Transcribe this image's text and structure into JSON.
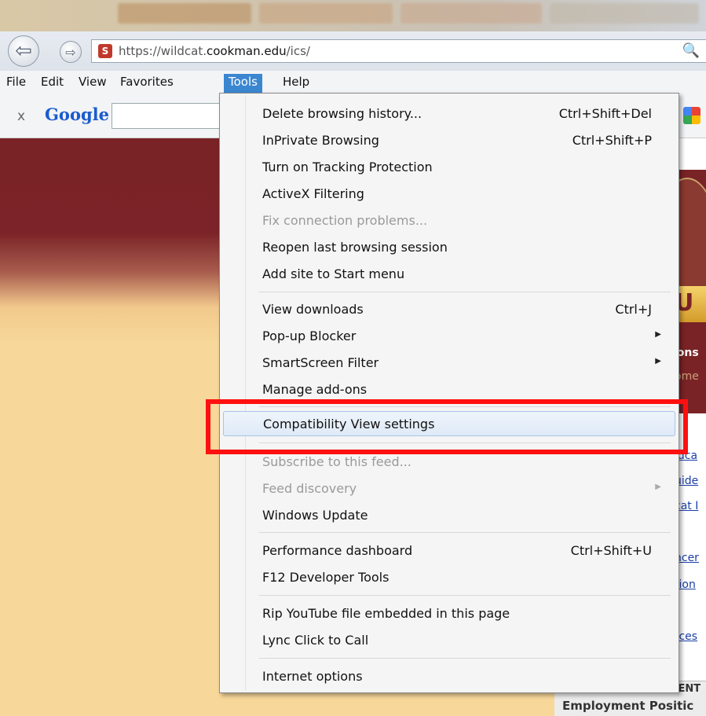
{
  "browser": {
    "url_prefix": "https://wildcat.",
    "url_host": "cookman.edu",
    "url_suffix": "/ics/",
    "search_icon": "🔍"
  },
  "menubar": {
    "items": [
      "File",
      "Edit",
      "View",
      "Favorites",
      "Tools",
      "Help"
    ],
    "active": "Tools"
  },
  "google_toolbar": {
    "close_glyph": "x",
    "logo": "Google",
    "search_value": ""
  },
  "tools_menu": {
    "items": [
      {
        "label": "Delete browsing history...",
        "shortcut": "Ctrl+Shift+Del"
      },
      {
        "label": "InPrivate Browsing",
        "shortcut": "Ctrl+Shift+P"
      },
      {
        "label": "Turn on Tracking Protection",
        "shortcut": ""
      },
      {
        "label": "ActiveX Filtering",
        "shortcut": ""
      },
      {
        "label": "Fix connection problems...",
        "shortcut": "",
        "disabled": true
      },
      {
        "label": "Reopen last browsing session",
        "shortcut": ""
      },
      {
        "label": "Add site to Start menu",
        "shortcut": ""
      },
      {
        "label": "View downloads",
        "shortcut": "Ctrl+J"
      },
      {
        "label": "Pop-up Blocker",
        "shortcut": "",
        "submenu": true
      },
      {
        "label": "SmartScreen Filter",
        "shortcut": "",
        "submenu": true
      },
      {
        "label": "Manage add-ons",
        "shortcut": ""
      },
      {
        "label": "Compatibility View settings",
        "shortcut": "",
        "highlighted": true
      },
      {
        "label": "Subscribe to this feed...",
        "shortcut": "",
        "disabled": true
      },
      {
        "label": "Feed discovery",
        "shortcut": "",
        "disabled": true,
        "submenu": true
      },
      {
        "label": "Windows Update",
        "shortcut": ""
      },
      {
        "label": "Performance dashboard",
        "shortcut": "Ctrl+Shift+U"
      },
      {
        "label": "F12 Developer Tools",
        "shortcut": ""
      },
      {
        "label": "Rip YouTube file embedded in this page",
        "shortcut": ""
      },
      {
        "label": "Lync Click to Call",
        "shortcut": ""
      },
      {
        "label": "Internet options",
        "shortcut": ""
      }
    ]
  },
  "page_peek": {
    "logo_fragment": "U",
    "links": [
      "ions",
      "ome",
      "ldca",
      "uide",
      "cat I",
      "ncer",
      "tion",
      "rces"
    ],
    "footer_s": "s",
    "footer_cent": "CENT",
    "footer_employment": "Employment Positic"
  },
  "colors": {
    "highlight": "#ff1010",
    "active_menu": "#3a86d1",
    "banner": "#7a2326",
    "page_bg": "#f7d79a"
  }
}
